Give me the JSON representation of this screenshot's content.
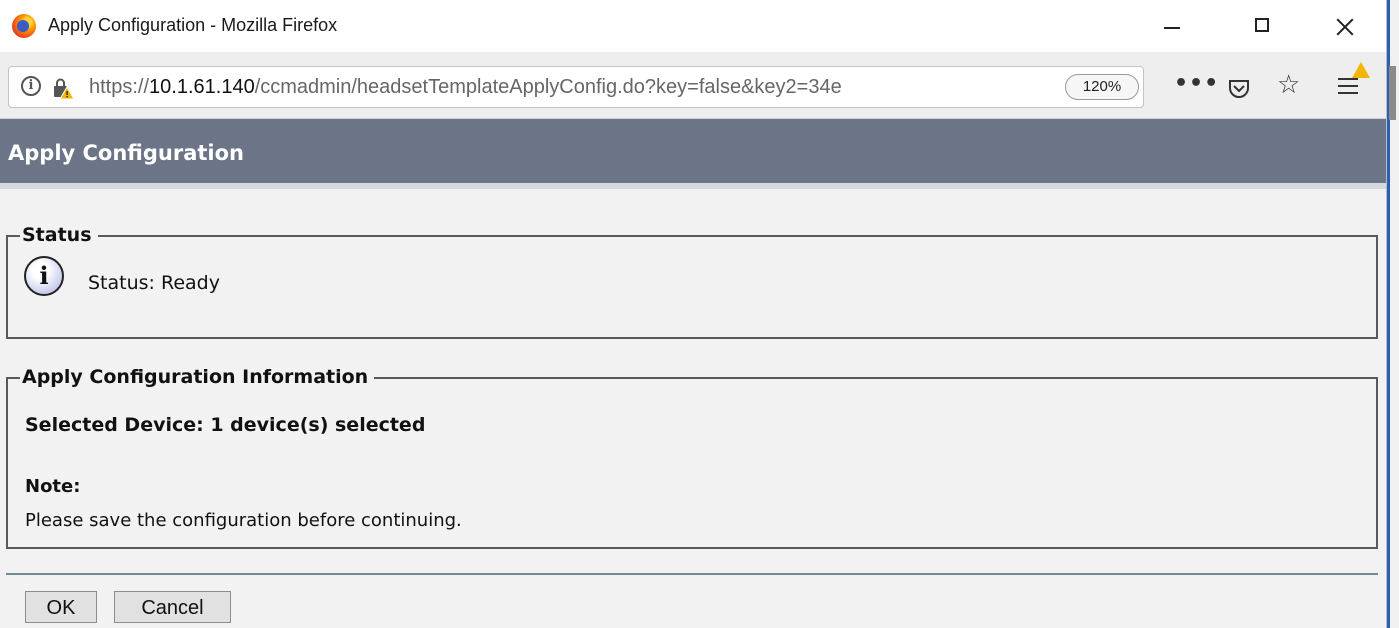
{
  "window": {
    "title": "Apply Configuration - Mozilla Firefox"
  },
  "browser": {
    "url_prefix": "https://",
    "url_host": "10.1.61.140",
    "url_path": "/ccmadmin/headsetTemplateApplyConfig.do?key=false&key2=34e",
    "zoom": "120%",
    "icons": [
      "info-icon",
      "lock-warning-icon",
      "more-icon",
      "pocket-icon",
      "bookmark-star-icon",
      "menu-icon",
      "update-warning-icon"
    ]
  },
  "page": {
    "title": "Apply Configuration"
  },
  "status_section": {
    "legend": "Status",
    "icon": "info-icon",
    "icon_glyph": "i",
    "text": "Status: Ready"
  },
  "info_section": {
    "legend": "Apply Configuration Information",
    "selected_device": "Selected Device: 1 device(s) selected",
    "note_label": "Note:",
    "note_text": "Please save the configuration before continuing."
  },
  "buttons": {
    "ok": "OK",
    "cancel": "Cancel"
  },
  "colors": {
    "header_bg": "#6c7487",
    "page_bg": "#f2f2f2",
    "separator": "#6f8b95"
  }
}
